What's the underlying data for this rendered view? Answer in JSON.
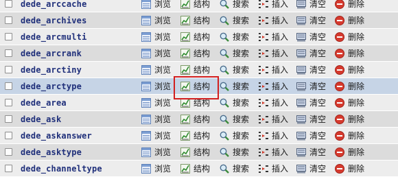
{
  "actions": {
    "browse": "浏览",
    "structure": "结构",
    "search": "搜索",
    "insert": "插入",
    "empty": "清空",
    "drop": "删除"
  },
  "colors": {
    "row_odd": "#ededed",
    "row_even": "#dcdcdc",
    "row_highlight": "#c6d4e6",
    "table_name": "#1f2f7a",
    "highlight_box": "#d21e1e"
  },
  "icons": {
    "browse": "browse-icon",
    "structure": "structure-icon",
    "search": "search-icon",
    "insert": "insert-icon",
    "empty": "empty-icon",
    "drop": "drop-icon"
  },
  "rows": [
    {
      "name": "dede_arccache"
    },
    {
      "name": "dede_archives"
    },
    {
      "name": "dede_arcmulti"
    },
    {
      "name": "dede_arcrank"
    },
    {
      "name": "dede_arctiny"
    },
    {
      "name": "dede_arctype"
    },
    {
      "name": "dede_area"
    },
    {
      "name": "dede_ask"
    },
    {
      "name": "dede_askanswer"
    },
    {
      "name": "dede_asktype"
    },
    {
      "name": "dede_channeltype"
    }
  ]
}
